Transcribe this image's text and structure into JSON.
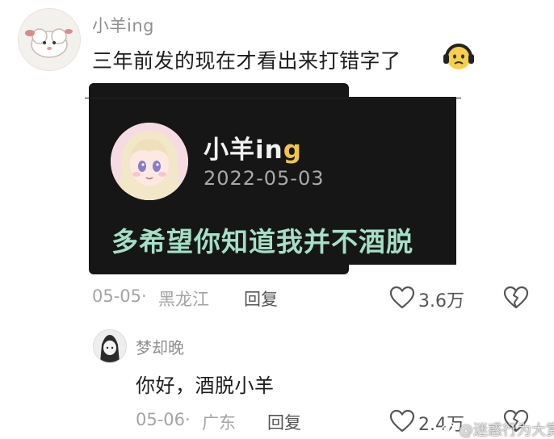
{
  "top_comment": {
    "username": "小羊ing",
    "text": "三年前发的现在才看出来打错字了",
    "emoji": "headphone-face-emoji",
    "date": "05-05",
    "location": "黑龙江",
    "reply_label": "回复",
    "likes": "3.6万"
  },
  "screenshot_card": {
    "username_prefix": "小羊in",
    "username_suffix": "g",
    "date": "2022-05-03",
    "quote": "多希望你知道我并不酒脱",
    "quote_color": "#a4dfc7",
    "background": "#161616"
  },
  "reply_comment": {
    "username": "梦却晚",
    "text": "你好，酒脱小羊",
    "date": "05-06",
    "location": "广东",
    "reply_label": "回复",
    "likes": "2.4万"
  },
  "meta_separator": " · ",
  "icons": [
    "heart-icon",
    "broken-heart-icon",
    "weibo-icon"
  ],
  "watermark": "@迷惑行为大赏"
}
